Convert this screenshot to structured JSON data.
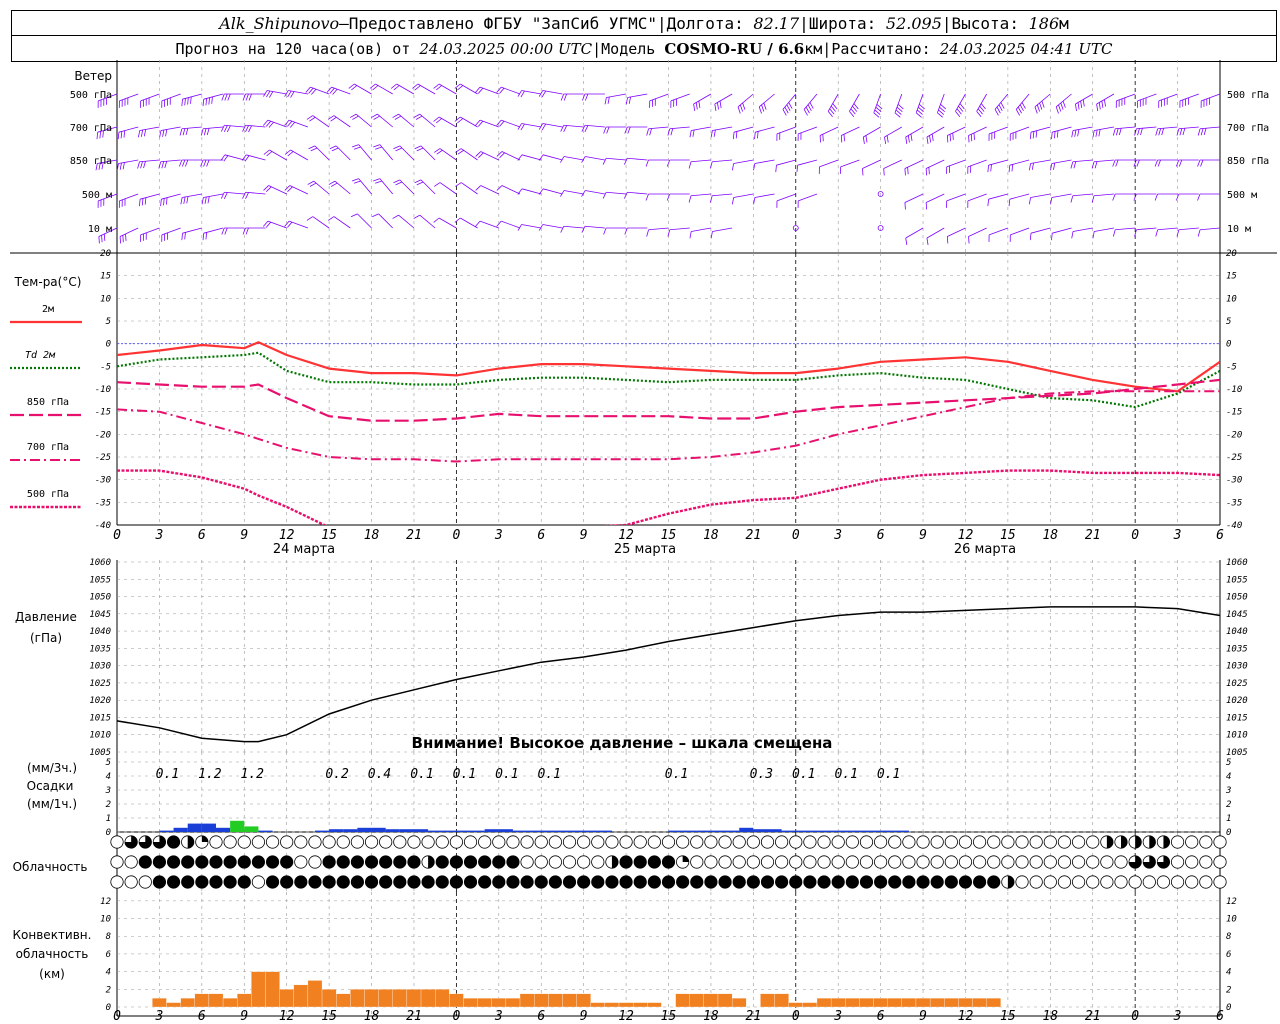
{
  "header": {
    "station": "Alk_Shipunovo",
    "dash": " – ",
    "provider": "Предоставлено ФГБУ \"ЗапСиб УГМС\"",
    "lon_label": "Долгота:",
    "lon_value": "82.17",
    "lat_label": "Широта:",
    "lat_value": "52.095",
    "alt_label": "Высота:",
    "alt_value": "186",
    "alt_unit": "м",
    "sep": " | "
  },
  "subheader": {
    "forecast_prefix": "Прогноз на 120 часа(ов) от",
    "forecast_time": "24.03.2025 00:00 UTC",
    "model_label": "Модель",
    "model_name": "COSMO-RU / 6.6",
    "model_unit": "км",
    "calc_label": "Рассчитано:",
    "calc_time": "24.03.2025 04:41 UTC",
    "sep": " | "
  },
  "wind_panel": {
    "title": "Ветер",
    "levels": [
      "500 гПа",
      "700 гПа",
      "850 гПа",
      "500 м",
      "10  м"
    ],
    "color": "#7f00ff"
  },
  "temp_panel": {
    "title": "Тем-ра(°С)",
    "legend": [
      {
        "label": "2м",
        "color": "#ff3333",
        "style": "solid"
      },
      {
        "label": "Td 2м",
        "color": "#007700",
        "style": "dotted"
      },
      {
        "label": "850 гПа",
        "color": "#e8106e",
        "style": "longdash"
      },
      {
        "label": "700 гПа",
        "color": "#e8106e",
        "style": "dashdot"
      },
      {
        "label": "500 гПа",
        "color": "#e8106e",
        "style": "dense"
      }
    ],
    "y_ticks": [
      "20",
      "15",
      "10",
      "5",
      "0",
      "-5",
      "-10",
      "-15",
      "-20",
      "-25",
      "-30",
      "-35",
      "-40"
    ]
  },
  "x_axis": {
    "hour_labels": [
      "0",
      "3",
      "6",
      "9",
      "12",
      "15",
      "18",
      "21",
      "0",
      "3",
      "6",
      "9",
      "12",
      "15",
      "18",
      "21",
      "0",
      "3",
      "6",
      "9",
      "12",
      "15",
      "18",
      "21",
      "0",
      "3",
      "6"
    ],
    "day_labels": [
      "24 марта",
      "25 марта",
      "26 марта"
    ]
  },
  "pressure_panel": {
    "title": "Давление",
    "unit": "(гПа)",
    "warning": "Внимание! Высокое давление – шкала смещена",
    "y_ticks": [
      "1060",
      "1055",
      "1050",
      "1045",
      "1040",
      "1035",
      "1030",
      "1025",
      "1020",
      "1015",
      "1010",
      "1005"
    ]
  },
  "precip_panel": {
    "unit1": "(мм/3ч.)",
    "title": "Осадки",
    "unit2": "(мм/1ч.)",
    "y_ticks": [
      "5",
      "4",
      "3",
      "2",
      "1",
      "0"
    ],
    "amounts": [
      {
        "h": 3,
        "v": "0.1"
      },
      {
        "h": 6,
        "v": "1.2"
      },
      {
        "h": 9,
        "v": "1.2"
      },
      {
        "h": 15,
        "v": "0.2"
      },
      {
        "h": 18,
        "v": "0.4"
      },
      {
        "h": 21,
        "v": "0.1"
      },
      {
        "h": 24,
        "v": "0.1"
      },
      {
        "h": 27,
        "v": "0.1"
      },
      {
        "h": 30,
        "v": "0.1"
      },
      {
        "h": 39,
        "v": "0.1"
      },
      {
        "h": 45,
        "v": "0.3"
      },
      {
        "h": 48,
        "v": "0.1"
      },
      {
        "h": 51,
        "v": "0.1"
      },
      {
        "h": 54,
        "v": "0.1"
      }
    ]
  },
  "cloud_panel": {
    "title": "Облачность"
  },
  "conv_panel": {
    "title1": "Конвективн.",
    "title2": "облачность",
    "unit": "(км)",
    "y_ticks": [
      "12",
      "10",
      "8",
      "6",
      "4",
      "2",
      "0"
    ]
  },
  "colors": {
    "grid": "#999999",
    "wind": "#7f00ff",
    "t2m": "#ff3333",
    "td": "#007700",
    "upper": "#e8106e",
    "zero_line": "#4444ff",
    "rain": "#1a3fd6",
    "rain_heavy": "#22cc22",
    "conv": "#f08020"
  },
  "chart_data": [
    {
      "type": "line",
      "title": "Тем-ра(°С)",
      "ylim": [
        -40,
        20
      ],
      "x_hours": [
        0,
        3,
        6,
        9,
        10,
        12,
        15,
        18,
        21,
        24,
        27,
        30,
        33,
        36,
        39,
        42,
        45,
        48,
        51,
        54,
        57,
        60,
        63,
        66,
        69,
        72,
        75,
        78
      ],
      "series": [
        {
          "name": "2м",
          "values": [
            -2.5,
            -1.5,
            -0.3,
            -1,
            0.3,
            -2.5,
            -5.5,
            -6.5,
            -6.5,
            -7,
            -5.5,
            -4.5,
            -4.5,
            -5,
            -5.5,
            -6,
            -6.5,
            -6.5,
            -5.5,
            -4,
            -3.5,
            -3,
            -4,
            -6,
            -8,
            -9.5,
            -10.5,
            -4
          ]
        },
        {
          "name": "Td 2м",
          "values": [
            -5,
            -3.5,
            -3,
            -2.5,
            -2,
            -6,
            -8.5,
            -8.5,
            -9,
            -9,
            -8,
            -7.5,
            -7.5,
            -8,
            -8.5,
            -8,
            -8,
            -8,
            -7,
            -6.5,
            -7.5,
            -8,
            -10,
            -12,
            -12.5,
            -14,
            -11,
            -6
          ]
        },
        {
          "name": "850 гПа",
          "values": [
            -8.5,
            -9,
            -9.5,
            -9.5,
            -9,
            -12,
            -16,
            -17,
            -17,
            -16.5,
            -15.5,
            -16,
            -16,
            -16,
            -16,
            -16.5,
            -16.5,
            -15,
            -14,
            -13.5,
            -13,
            -12.5,
            -12,
            -11.5,
            -11,
            -10,
            -9,
            -8
          ]
        },
        {
          "name": "700 гПа",
          "values": [
            -14.5,
            -15,
            -17.5,
            -20,
            -21,
            -23,
            -25,
            -25.5,
            -25.5,
            -26,
            -25.5,
            -25.5,
            -25.5,
            -25.5,
            -25.5,
            -25,
            -24,
            -22.5,
            -20,
            -18,
            -16,
            -14,
            -12,
            -11,
            -10.5,
            -10.5,
            -10.5,
            -10.5
          ]
        },
        {
          "name": "500 гПа",
          "values": [
            -28,
            -28,
            -29.5,
            -32,
            -33.5,
            -36,
            -40.5,
            -42,
            -42,
            -42,
            -41,
            -40.5,
            -40.5,
            -40,
            -37.5,
            -35.5,
            -34.5,
            -34,
            -32,
            -30,
            -29,
            -28.5,
            -28,
            -28,
            -28.5,
            -28.5,
            -28.5,
            -29
          ]
        }
      ]
    },
    {
      "type": "line",
      "title": "Давление",
      "ylim": [
        1005,
        1060
      ],
      "x_hours": [
        0,
        3,
        6,
        9,
        10,
        12,
        15,
        18,
        21,
        24,
        27,
        30,
        33,
        36,
        39,
        42,
        45,
        48,
        51,
        54,
        57,
        60,
        63,
        66,
        69,
        72,
        75,
        78
      ],
      "series": [
        {
          "name": "Давление",
          "values": [
            1014,
            1012,
            1009,
            1008,
            1008,
            1010,
            1016,
            1020,
            1023,
            1026,
            1028.5,
            1031,
            1032.5,
            1034.5,
            1037,
            1039,
            1041,
            1043,
            1044.5,
            1045.5,
            1045.5,
            1046,
            1046.5,
            1047,
            1047,
            1047,
            1046.5,
            1044.5
          ]
        }
      ]
    },
    {
      "type": "bar",
      "title": "Осадки",
      "ylim": [
        0,
        5
      ],
      "x_hours": [
        4,
        5,
        6,
        7,
        8,
        9,
        10,
        11,
        12,
        13,
        14,
        15,
        16,
        17,
        18,
        19,
        20,
        21,
        22,
        23,
        24,
        25,
        26,
        27,
        28,
        29,
        30,
        31,
        32,
        33,
        34,
        35,
        36,
        37,
        38,
        39,
        40,
        41,
        42,
        43,
        44,
        45,
        46,
        47,
        48,
        49,
        50,
        51,
        52,
        53,
        54,
        55,
        56
      ],
      "values": [
        0.1,
        0.3,
        0.6,
        0.6,
        0.3,
        0.8,
        0.4,
        0.1,
        0,
        0,
        0,
        0.1,
        0.2,
        0.2,
        0.3,
        0.3,
        0.2,
        0.2,
        0.2,
        0.1,
        0.1,
        0.1,
        0.1,
        0.2,
        0.2,
        0.1,
        0.1,
        0.1,
        0.1,
        0.1,
        0.1,
        0.1,
        0,
        0,
        0,
        0,
        0.1,
        0.1,
        0.1,
        0.1,
        0.1,
        0.3,
        0.2,
        0.2,
        0.1,
        0.1,
        0.1,
        0.1,
        0.1,
        0.1,
        0.1,
        0.1,
        0.1
      ]
    },
    {
      "type": "bar",
      "title": "Конвективн. облачность",
      "ylim": [
        0,
        13
      ],
      "x_hours": [
        2,
        3,
        4,
        5,
        6,
        7,
        8,
        9,
        10,
        11,
        12,
        13,
        14,
        15,
        16,
        17,
        18,
        19,
        20,
        21,
        22,
        23,
        24,
        25,
        26,
        27,
        28,
        29,
        30,
        31,
        32,
        33,
        34,
        35,
        36,
        37,
        38,
        39,
        40,
        41,
        42,
        43,
        44,
        45,
        46,
        47,
        48,
        49,
        50,
        51,
        52,
        53,
        54,
        55,
        56,
        57,
        58,
        59,
        60,
        61,
        62,
        63,
        64,
        65,
        66,
        67,
        68,
        69,
        70,
        71,
        72,
        73,
        74,
        75,
        76,
        77
      ],
      "values": [
        0,
        1,
        0.5,
        1,
        1.5,
        1.5,
        1,
        1.5,
        4,
        4,
        2,
        2.5,
        3,
        2,
        1.5,
        2,
        2,
        2,
        2,
        2,
        2,
        2,
        1.5,
        1,
        1,
        1,
        1,
        1.5,
        1.5,
        1.5,
        1.5,
        1.5,
        0.5,
        0.5,
        0.5,
        0.5,
        0.5,
        0,
        1.5,
        1.5,
        1.5,
        1.5,
        1,
        0,
        1.5,
        1.5,
        0.5,
        0.5,
        1,
        1,
        1,
        1,
        1,
        1,
        1,
        1,
        1,
        1,
        1,
        1,
        1,
        0,
        0,
        0,
        0,
        0,
        0,
        0,
        0,
        0,
        0,
        0,
        0,
        0,
        0,
        0
      ]
    }
  ]
}
